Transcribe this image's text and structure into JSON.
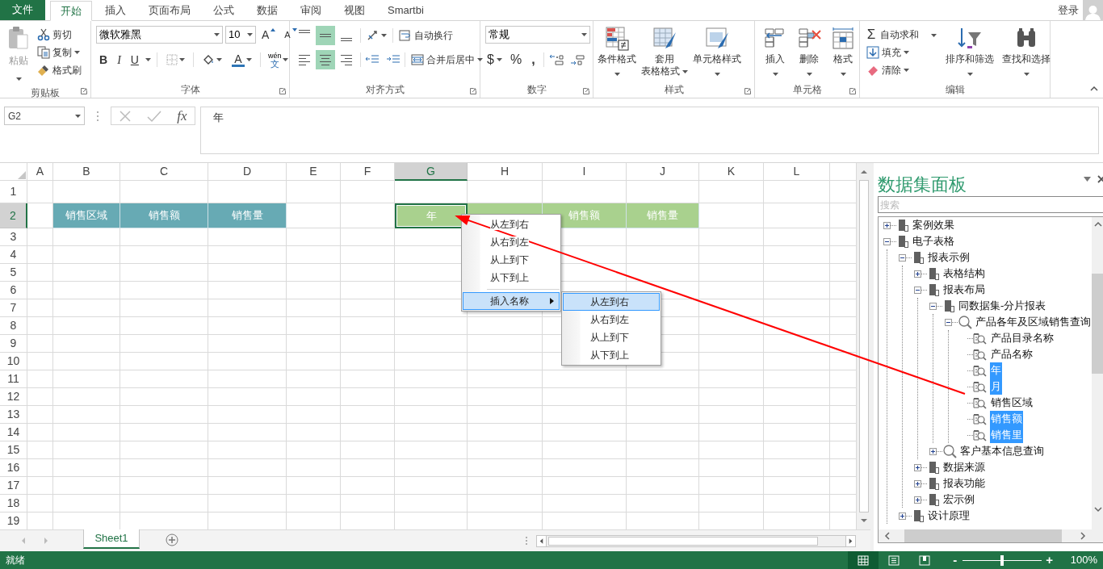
{
  "title_bar": {
    "file_tab": "文件",
    "tabs": [
      {
        "label": "开始",
        "selected": true
      },
      {
        "label": "插入",
        "selected": false
      },
      {
        "label": "页面布局",
        "selected": false
      },
      {
        "label": "公式",
        "selected": false
      },
      {
        "label": "数据",
        "selected": false
      },
      {
        "label": "审阅",
        "selected": false
      },
      {
        "label": "视图",
        "selected": false
      },
      {
        "label": "Smartbi",
        "selected": false
      }
    ],
    "sign_in": "登录"
  },
  "ribbon": {
    "clipboard": {
      "label": "剪贴板",
      "paste": {
        "label": "粘贴",
        "disabled": true
      },
      "cut": "剪切",
      "copy": "复制",
      "format_painter": "格式刷"
    },
    "font": {
      "label": "字体",
      "font_name": "微软雅黑",
      "font_size": "10",
      "grow": "A",
      "shrink": "A",
      "bold": "B",
      "italic": "I",
      "underline": "U",
      "font_color": "A",
      "phonetic_top": "wén",
      "phonetic_bottom": "文"
    },
    "alignment": {
      "label": "对齐方式",
      "vertical": [
        {
          "selected": false
        },
        {
          "selected": true
        },
        {
          "selected": false
        }
      ],
      "horizontal": [
        {
          "selected": false
        },
        {
          "selected": true
        },
        {
          "selected": false
        }
      ],
      "wrap_text": "自动换行",
      "merge_center": "合并后居中"
    },
    "number": {
      "label": "数字",
      "format": "常规",
      "currency": "$",
      "percent": "%",
      "comma": ","
    },
    "styles": {
      "label": "样式",
      "buttons": [
        {
          "lines": [
            "条件格式"
          ]
        },
        {
          "lines": [
            "套用",
            "表格格式"
          ]
        },
        {
          "lines": [
            "单元格样式"
          ]
        }
      ]
    },
    "cells": {
      "label": "单元格",
      "buttons": [
        "插入",
        "删除",
        "格式"
      ]
    },
    "editing": {
      "label": "编辑",
      "sum_symbol": "Σ",
      "autosum": "自动求和",
      "fill": "填充",
      "clear": "清除",
      "sort_filter": "排序和筛选",
      "find_select": "查找和选择"
    }
  },
  "formula_bar": {
    "name_box": "G2",
    "function_label": "fx",
    "content": "年"
  },
  "sheet": {
    "columns": [
      {
        "label": "A",
        "selected": false
      },
      {
        "label": "B",
        "selected": false
      },
      {
        "label": "C",
        "selected": false
      },
      {
        "label": "D",
        "selected": false
      },
      {
        "label": "E",
        "selected": false
      },
      {
        "label": "F",
        "selected": false
      },
      {
        "label": "G",
        "selected": true
      },
      {
        "label": "H",
        "selected": false
      },
      {
        "label": "I",
        "selected": false
      },
      {
        "label": "J",
        "selected": false
      },
      {
        "label": "K",
        "selected": false
      },
      {
        "label": "L",
        "selected": false
      }
    ],
    "rows": [
      {
        "label": "1",
        "selected": false
      },
      {
        "label": "2",
        "selected": true,
        "cells": [
          null,
          {
            "text": "销售区域",
            "color": "#67aab4",
            "selected": false
          },
          {
            "text": "销售额",
            "color": "#67aab4",
            "selected": false
          },
          {
            "text": "销售量",
            "color": "#67aab4",
            "selected": false
          },
          null,
          null,
          {
            "text": "年",
            "color": "#a9d18e",
            "selected": true
          },
          {
            "color": "#a9d18e",
            "selected": false
          },
          {
            "text": "销售额",
            "color": "#a9d18e",
            "selected": false
          },
          {
            "text": "销售量",
            "color": "#a9d18e",
            "selected": false
          },
          null,
          null
        ]
      },
      {
        "label": "3",
        "selected": false
      },
      {
        "label": "4",
        "selected": false
      },
      {
        "label": "5",
        "selected": false
      },
      {
        "label": "6",
        "selected": false
      },
      {
        "label": "7",
        "selected": false
      },
      {
        "label": "8",
        "selected": false
      },
      {
        "label": "9",
        "selected": false
      },
      {
        "label": "10",
        "selected": false
      },
      {
        "label": "11",
        "selected": false
      },
      {
        "label": "12",
        "selected": false
      },
      {
        "label": "13",
        "selected": false
      },
      {
        "label": "14",
        "selected": false
      },
      {
        "label": "15",
        "selected": false
      },
      {
        "label": "16",
        "selected": false
      },
      {
        "label": "17",
        "selected": false
      },
      {
        "label": "18",
        "selected": false
      },
      {
        "label": "19",
        "selected": false
      }
    ],
    "tabs": [
      {
        "label": "Sheet1",
        "selected": true
      }
    ]
  },
  "context_menu": {
    "items": [
      {
        "kind": "item",
        "label": "从左到右",
        "selected": false
      },
      {
        "kind": "item",
        "label": "从右到左",
        "selected": false
      },
      {
        "kind": "item",
        "label": "从上到下",
        "selected": false
      },
      {
        "kind": "item",
        "label": "从下到上",
        "selected": false
      },
      {
        "kind": "separator"
      },
      {
        "kind": "submenu",
        "label": "插入名称",
        "selected": true
      }
    ],
    "submenu": [
      {
        "label": "从左到右",
        "selected": true
      },
      {
        "label": "从右到左",
        "selected": false
      },
      {
        "label": "从上到下",
        "selected": false
      },
      {
        "label": "从下到上",
        "selected": false
      }
    ]
  },
  "dataset_panel": {
    "title": "数据集面板",
    "search_placeholder": "搜索",
    "tree": [
      {
        "label": "案例效果",
        "kind": "folder",
        "expanded": false,
        "selected": false
      },
      {
        "label": "电子表格",
        "kind": "folder",
        "expanded": true,
        "selected": false,
        "children": [
          {
            "label": "报表示例",
            "kind": "folder",
            "expanded": true,
            "selected": false,
            "children": [
              {
                "label": "表格结构",
                "kind": "folder",
                "expanded": false,
                "selected": false
              },
              {
                "label": "报表布局",
                "kind": "folder",
                "expanded": true,
                "selected": false,
                "children": [
                  {
                    "label": "同数据集-分片报表",
                    "kind": "folder",
                    "expanded": true,
                    "selected": false,
                    "children": [
                      {
                        "label": "产品各年及区域销售查询",
                        "kind": "query",
                        "expanded": true,
                        "selected": false,
                        "children": [
                          {
                            "label": "产品目录名称",
                            "kind": "field",
                            "selected": false
                          },
                          {
                            "label": "产品名称",
                            "kind": "field",
                            "selected": false
                          },
                          {
                            "label": "年",
                            "kind": "field",
                            "selected": true
                          },
                          {
                            "label": "月",
                            "kind": "field",
                            "selected": true
                          },
                          {
                            "label": "销售区域",
                            "kind": "field",
                            "selected": false
                          },
                          {
                            "label": "销售额",
                            "kind": "field",
                            "selected": true
                          },
                          {
                            "label": "销售里",
                            "kind": "field",
                            "selected": true
                          }
                        ]
                      }
                    ]
                  },
                  {
                    "label": "客户基本信息查询",
                    "kind": "query",
                    "expanded": false,
                    "selected": false
                  }
                ]
              },
              {
                "label": "数据来源",
                "kind": "folder",
                "expanded": false,
                "selected": false
              },
              {
                "label": "报表功能",
                "kind": "folder",
                "expanded": false,
                "selected": false
              },
              {
                "label": "宏示例",
                "kind": "folder",
                "expanded": false,
                "selected": false
              }
            ]
          },
          {
            "label": "设计原理",
            "kind": "folder",
            "expanded": false,
            "selected": false
          }
        ]
      }
    ]
  },
  "status_bar": {
    "status": "就绪",
    "views": [
      {
        "selected": true
      },
      {
        "selected": false
      },
      {
        "selected": false
      }
    ],
    "zoom_out": "-",
    "zoom_in": "+",
    "zoom": {
      "level": 0.5,
      "reading": "100%"
    }
  }
}
